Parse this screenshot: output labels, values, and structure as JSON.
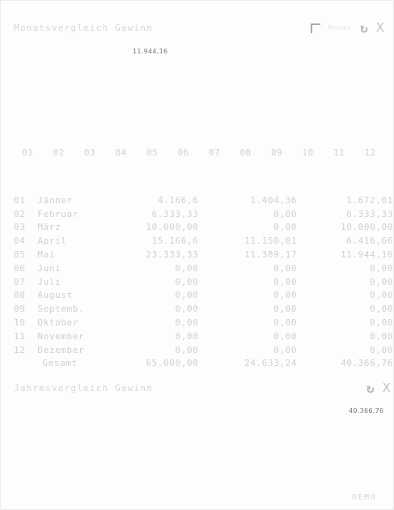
{
  "monthly_widget": {
    "title": "Monatsvergleich Gewinn",
    "header_faint_label": "Monat",
    "highlight_value": "11.944,16",
    "months": [
      "01",
      "02",
      "03",
      "04",
      "05",
      "06",
      "07",
      "08",
      "09",
      "10",
      "11",
      "12"
    ],
    "rows": [
      {
        "num": "01",
        "name": "Jänner",
        "v1": "4.166,6",
        "v2": "1.404,36",
        "v3": "1.672,01"
      },
      {
        "num": "02",
        "name": "Februar",
        "v1": "6.333,33",
        "v2": "0,00",
        "v3": "6.333,33"
      },
      {
        "num": "03",
        "name": "März",
        "v1": "10.000,00",
        "v2": "0,00",
        "v3": "10.000,00"
      },
      {
        "num": "04",
        "name": "April",
        "v1": "15.166,6",
        "v2": "11.150,01",
        "v3": "6.416,66"
      },
      {
        "num": "05",
        "name": "Mai",
        "v1": "23.333,33",
        "v2": "11.389,17",
        "v3": "11.944,16"
      },
      {
        "num": "06",
        "name": "Juni",
        "v1": "0,00",
        "v2": "0,00",
        "v3": "0,00"
      },
      {
        "num": "07",
        "name": "Juli",
        "v1": "0,00",
        "v2": "0,00",
        "v3": "0,00"
      },
      {
        "num": "08",
        "name": "August",
        "v1": "0,00",
        "v2": "0,00",
        "v3": "0,00"
      },
      {
        "num": "09",
        "name": "Septemb.",
        "v1": "0,00",
        "v2": "0,00",
        "v3": "0,00"
      },
      {
        "num": "10",
        "name": "Oktober",
        "v1": "0,00",
        "v2": "0,00",
        "v3": "0,00"
      },
      {
        "num": "11",
        "name": "November",
        "v1": "0,00",
        "v2": "0,00",
        "v3": "0,00"
      },
      {
        "num": "12",
        "name": "Dezember",
        "v1": "0,00",
        "v2": "0,00",
        "v3": "0,00"
      }
    ],
    "total": {
      "label": "Gesamt",
      "v1": "65.000,00",
      "v2": "24.633,24",
      "v3": "40.366,76"
    }
  },
  "yearly_widget": {
    "title": "Jahresvergleich Gewinn",
    "highlight_value": "40.366,76"
  },
  "icons": {
    "expand": "expand-icon",
    "refresh": "refresh-icon",
    "close": "close-icon"
  },
  "footer": {
    "text": "DEMO"
  },
  "colors": {
    "faint_text": "#d0d0d4",
    "value_text": "#77777c",
    "background": "#fdfdfe"
  }
}
